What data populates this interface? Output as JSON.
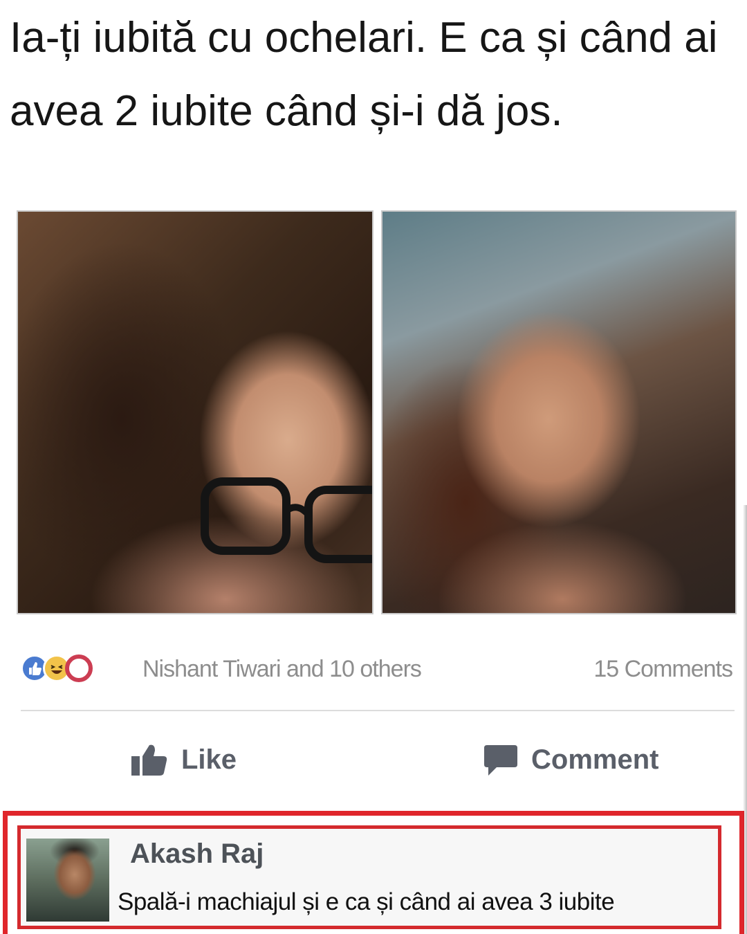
{
  "post": {
    "caption": "Ia-ți iubită cu ochelari. E ca și când ai avea 2 iubite când și-i dă jos.",
    "photos": [
      {
        "description_icon": "photo-with-glasses"
      },
      {
        "description_icon": "photo-without-glasses"
      }
    ]
  },
  "reactions": {
    "icons": [
      "like-reaction-icon",
      "haha-reaction-icon",
      "love-reaction-icon"
    ],
    "reactors_text": "Nishant Tiwari and 10 others",
    "comments_count_text": "15 Comments"
  },
  "actions": {
    "like_label": "Like",
    "comment_label": "Comment"
  },
  "comment": {
    "author": "Akash Raj",
    "text": "Spală-i machiajul și e ca și când ai avea 3 iubite"
  },
  "colors": {
    "highlight_border": "#e0262b",
    "like_blue": "#4a7bd0",
    "love_red": "#cc3d52",
    "haha_yellow": "#f2c34a",
    "muted_text": "#8d8d8d",
    "action_text": "#5a5f69"
  }
}
